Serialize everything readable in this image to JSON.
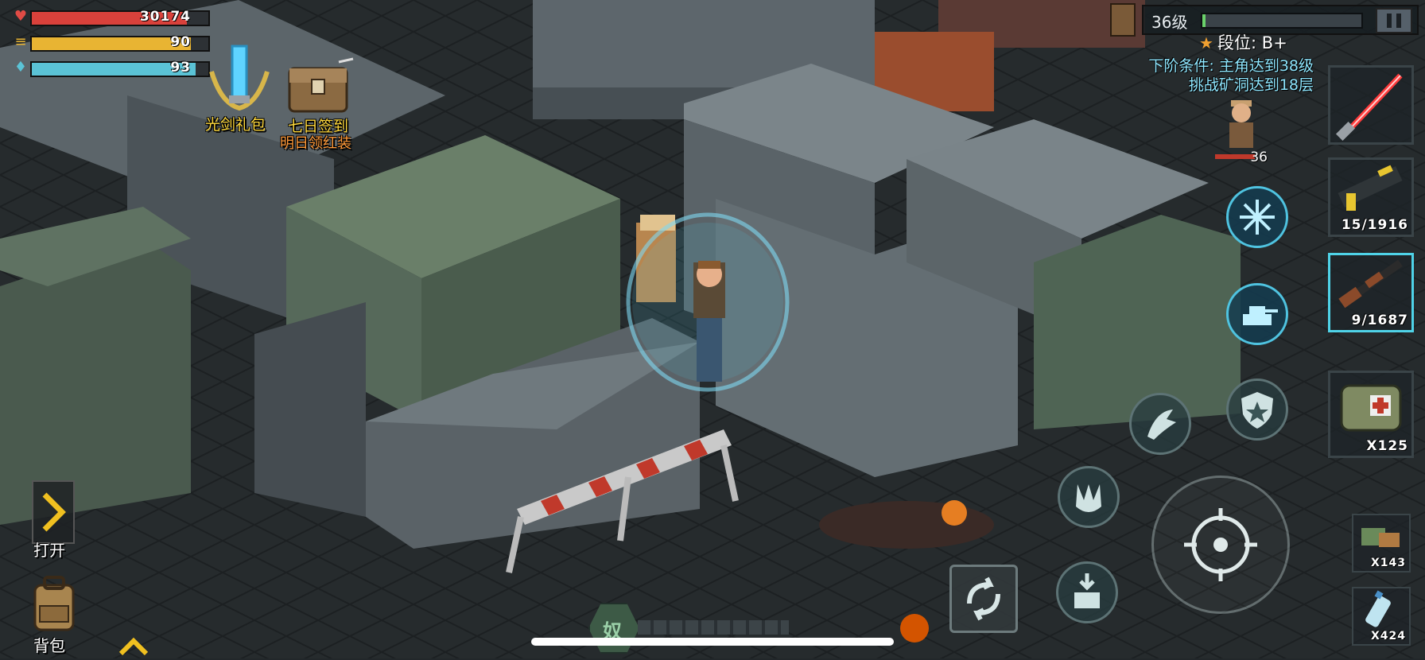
{
  "stats": {
    "health": {
      "value": "30174",
      "fill": 0.88,
      "color": "#d9413b"
    },
    "hunger": {
      "value": "90",
      "fill": 0.9,
      "color": "#e8b433"
    },
    "water": {
      "value": "93",
      "fill": 0.93,
      "color": "#5bc3d6"
    }
  },
  "events": {
    "saber_pack": "光剑礼包",
    "seven_day": "七日签到",
    "seven_day_sub": "明日领红装"
  },
  "level": {
    "label": "36级",
    "progress": 0.02
  },
  "rank": {
    "label": "段位: B+",
    "next_line1": "下阶条件: 主角达到38级",
    "next_line2": "挑战矿洞达到18层"
  },
  "companion": {
    "level": "36"
  },
  "weapons": [
    {
      "name": "lightsaber",
      "count": ""
    },
    {
      "name": "blaster-rifle",
      "count": "15/1916"
    },
    {
      "name": "shotgun",
      "count": "9/1687",
      "selected": true
    },
    {
      "name": "medkit-bag",
      "count": "X125"
    }
  ],
  "consumables": [
    {
      "name": "ration-pack",
      "count": "X143"
    },
    {
      "name": "water-bottle",
      "count": "X424"
    }
  ],
  "left": {
    "open_label": "打开",
    "bag_label": "背包"
  },
  "bottom_banner_text": "奴",
  "colors": {
    "accent": "#4fd3e8",
    "label": "#ffd93d"
  }
}
